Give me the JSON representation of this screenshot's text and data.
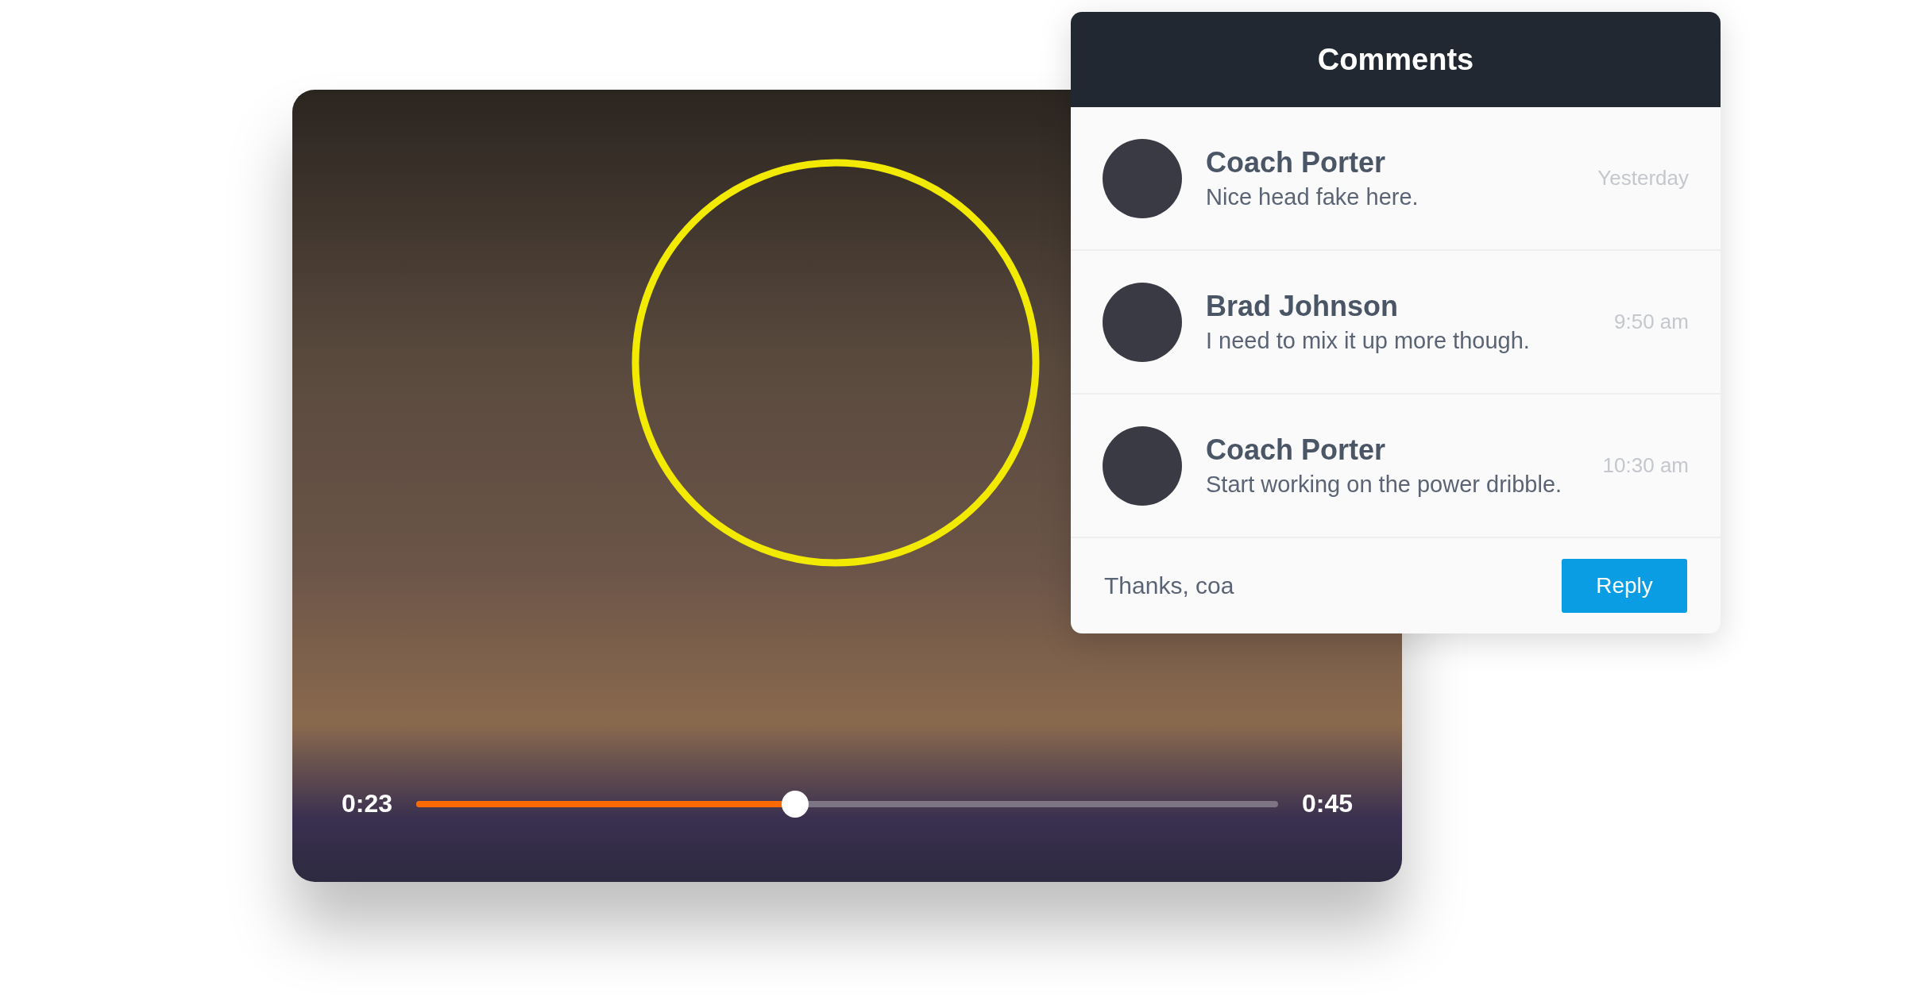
{
  "video": {
    "current_time": "0:23",
    "duration": "0:45",
    "level": 0.44
  },
  "comments_panel": {
    "title": "Comments",
    "comments": [
      {
        "author": "Coach Porter",
        "text": "Nice head fake here.",
        "time": "Yesterday"
      },
      {
        "author": "Brad Johnson",
        "text": "I need to mix it up more though.",
        "time": "9:50 am"
      },
      {
        "author": "Coach Porter",
        "text": "Start working on the power dribble.",
        "time": "10:30 am"
      }
    ],
    "reply_input": {
      "value": "Thanks, coa"
    },
    "reply_button": "Reply"
  }
}
